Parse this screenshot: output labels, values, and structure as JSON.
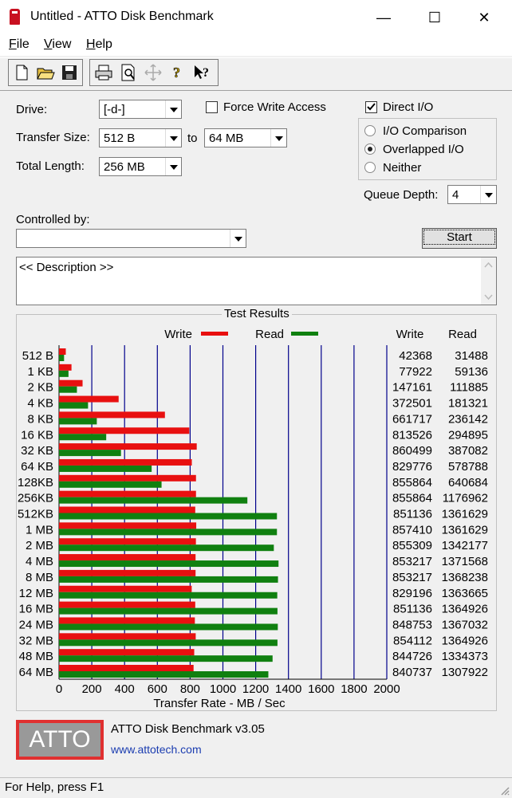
{
  "window": {
    "title": "Untitled - ATTO Disk Benchmark",
    "minimize_glyph": "—",
    "maximize_glyph": "☐",
    "close_glyph": "✕"
  },
  "menu": {
    "items": [
      {
        "ul": "F",
        "rest": "ile"
      },
      {
        "ul": "V",
        "rest": "iew"
      },
      {
        "ul": "H",
        "rest": "elp"
      }
    ]
  },
  "toolbar": {
    "icons": [
      "new-file-icon",
      "open-folder-icon",
      "save-disk-icon",
      "print-icon",
      "print-preview-icon",
      "move-icon",
      "help-icon",
      "context-help-icon"
    ]
  },
  "form": {
    "drive_label": "Drive:",
    "drive_value": "[-d-]",
    "force_write_label": "Force Write Access",
    "force_write_checked": false,
    "direct_io_label": "Direct I/O",
    "direct_io_checked": true,
    "transfer_size_label": "Transfer Size:",
    "transfer_from": "512 B",
    "to_label": "to",
    "transfer_to": "64 MB",
    "total_length_label": "Total Length:",
    "total_length_value": "256 MB",
    "io_options": [
      {
        "label": "I/O Comparison",
        "selected": false
      },
      {
        "label": "Overlapped I/O",
        "selected": true
      },
      {
        "label": "Neither",
        "selected": false
      }
    ],
    "queue_depth_label": "Queue Depth:",
    "queue_depth_value": "4",
    "controlled_by_label": "Controlled by:",
    "controlled_by_value": "",
    "start_label": "Start",
    "description": "<< Description >>"
  },
  "results": {
    "title": "Test Results",
    "write_col": "Write",
    "read_col": "Read"
  },
  "chart_data": {
    "type": "bar",
    "orientation": "horizontal",
    "categories": [
      "512 B",
      "1 KB",
      "2 KB",
      "4 KB",
      "8 KB",
      "16 KB",
      "32 KB",
      "64 KB",
      "128KB",
      "256KB",
      "512KB",
      "1 MB",
      "2 MB",
      "4 MB",
      "8 MB",
      "12 MB",
      "16 MB",
      "24 MB",
      "32 MB",
      "48 MB",
      "64 MB"
    ],
    "series": [
      {
        "name": "Write",
        "color": "#e81010",
        "values": [
          42368,
          77922,
          147161,
          372501,
          661717,
          813526,
          860499,
          829776,
          855864,
          855864,
          851136,
          857410,
          855309,
          853217,
          853217,
          829196,
          851136,
          848753,
          854112,
          844726,
          840737
        ]
      },
      {
        "name": "Read",
        "color": "#108010",
        "values": [
          31488,
          59136,
          111885,
          181321,
          236142,
          294895,
          387082,
          578788,
          640684,
          1176962,
          1361629,
          1361629,
          1342177,
          1371568,
          1368238,
          1363665,
          1364926,
          1367032,
          1364926,
          1334373,
          1307922
        ]
      }
    ],
    "x_ticks": [
      0,
      200,
      400,
      600,
      800,
      1000,
      1200,
      1400,
      1600,
      1800,
      2000
    ],
    "xlim": [
      0,
      2000
    ],
    "xlabel": "Transfer Rate - MB / Sec",
    "grid_color": "#00008b",
    "legend": "top"
  },
  "footer": {
    "logo_text": "ATTO",
    "product": "ATTO Disk Benchmark v3.05",
    "url": "www.attotech.com"
  },
  "status": {
    "text": "For Help, press F1"
  }
}
